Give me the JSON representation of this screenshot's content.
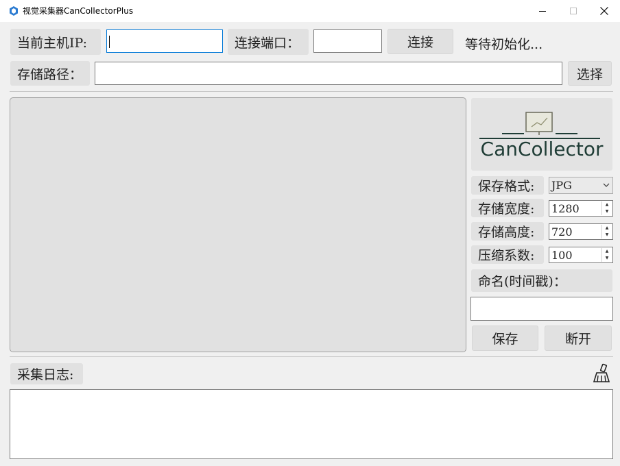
{
  "window": {
    "title": "视觉采集器CanCollectorPlus",
    "controls": {
      "minimize": "—",
      "maximize": "☐",
      "close": "✕"
    }
  },
  "connection": {
    "host_ip_label": "当前主机IP:",
    "host_ip_value": "",
    "port_label": "连接端口：",
    "port_value": "",
    "connect_button": "连接",
    "status_text": "等待初始化..."
  },
  "storage": {
    "path_label": "存储路径：",
    "path_value": "",
    "choose_button": "选择"
  },
  "logo": {
    "text": "CanCollector",
    "color": "#1f3d36"
  },
  "settings": {
    "format_label": "保存格式:",
    "format_value": "JPG",
    "width_label": "存储宽度:",
    "width_value": "1280",
    "height_label": "存储高度:",
    "height_value": "720",
    "compress_label": "压缩系数:",
    "compress_value": "100",
    "naming_label": "命名(时间戳)：",
    "naming_value": ""
  },
  "actions": {
    "save_button": "保存",
    "disconnect_button": "断开"
  },
  "log": {
    "label": "采集日志:",
    "content": "",
    "clear_icon": "broom-icon"
  }
}
